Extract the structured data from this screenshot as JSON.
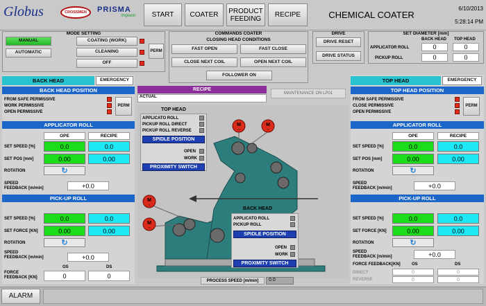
{
  "header": {
    "logo_text": "Globus",
    "badge_text": "CROSSMEN",
    "prisma_text": "PRISMA",
    "prisma_sub": "implanti",
    "nav": [
      "START",
      "COATER",
      "PRODUCT FEEDING",
      "RECIPE"
    ],
    "screen_title": "CHEMICAL COATER",
    "date": "6/10/2013",
    "time": "5:28:14 PM"
  },
  "mode": {
    "title": "MODE SETTING",
    "manual": "MANUAL",
    "automatic": "AUTOMATIC",
    "coating": "COATING (WORK)",
    "cleaning": "CLEANING",
    "off": "OFF",
    "perm": "PERM"
  },
  "commands": {
    "title": "COMMANDS COATER",
    "subtitle": "CLOSING HEAD CONDITIONS",
    "fast_open": "FAST OPEN",
    "fast_close": "FAST CLOSE",
    "close_next": "CLOSE NEXT COIL",
    "open_next": "OPEN NEXT COIL",
    "follower": "FOLLOWER ON"
  },
  "drive": {
    "title": "DRIVE",
    "reset": "DRIVE RESET",
    "status": "DRIVE STATUS"
  },
  "diameter": {
    "title": "SET DIAMETER [mm]",
    "col_back": "BACK HEAD",
    "col_top": "TOP HEAD",
    "applicator_label": "APPLICATOR ROLL",
    "pickup_label": "PICKUP ROLL",
    "app_back": "0",
    "app_top": "0",
    "pick_back": "0",
    "pick_top": "0"
  },
  "back": {
    "title": "BACK HEAD",
    "emergency": "EMERGENCY",
    "pos_title": "BACK HEAD POSITION",
    "safe": "FROM SAFE PERMISSIVE",
    "work": "WORK PERMISSIVE",
    "open": "OPEN PERMISSIVE",
    "perm": "PERM",
    "app_title": "APPLICATOR ROLL",
    "ope": "OPE",
    "recipe": "RECIPE",
    "set_speed": "SET SPEED [%]",
    "set_pos": "SET POS [mm]",
    "rotation": "ROTATION",
    "speed_fb_1": "SPEED",
    "speed_fb_2": "FEEDBACK [m/min]",
    "app_speed_ope": "0.0",
    "app_speed_rec": "0.0",
    "app_pos_ope": "0.00",
    "app_pos_rec": "0.00",
    "app_fb": "+0.0",
    "pick_title": "PICK-UP ROLL",
    "set_force": "SET FORCE [KN]",
    "pick_speed_ope": "0.0",
    "pick_speed_rec": "0.0",
    "pick_force_ope": "0.00",
    "pick_force_rec": "0.00",
    "pick_fb": "+0.0",
    "force_fb_1": "FORCE",
    "force_fb_2": "FEEDBACK [KN]",
    "os": "OS",
    "ds": "DS",
    "force_os": "0",
    "force_ds": "0"
  },
  "top": {
    "title": "TOP HEAD",
    "emergency": "EMERGENCY",
    "pos_title": "TOP HEAD POSITION",
    "safe": "FROM SAFE PERMISSIVE",
    "close": "CLOSE PERMISSIVE",
    "open": "OPEN PERMISSIVE",
    "perm": "PERM",
    "app_title": "APPLICATOR ROLL",
    "ope": "OPE",
    "recipe": "RECIPE",
    "set_speed": "SET SPEED [%]",
    "set_pos": "SET POS [mm]",
    "rotation": "ROTATION",
    "speed_fb_1": "SPEED",
    "speed_fb_2": "FEEDBACK [m/min]",
    "app_speed_ope": "0.0",
    "app_speed_rec": "0.0",
    "app_pos_ope": "0.00",
    "app_pos_rec": "0.00",
    "app_fb": "+0.0",
    "pick_title": "PICK-UP ROLL",
    "set_force": "SET FORCE [KN]",
    "pick_speed_ope": "0.0",
    "pick_speed_rec": "0.0",
    "pick_force_ope": "0.00",
    "pick_force_rec": "0.00",
    "pick_fb": "+0.0",
    "force_fb": "FORCE FEEDBACK[KN]",
    "os": "OS",
    "ds": "DS",
    "direct": "DIRECT",
    "reverse": "REVERSE",
    "dir_os": "0",
    "dir_ds": "0",
    "rev_os": "0",
    "rev_ds": "0"
  },
  "center": {
    "recipe_label": "RECIPE",
    "actual_label": "ACTUAL",
    "maintenance": "MAINTENANCE ON LP01",
    "top_head": "TOP HEAD",
    "top_items": [
      "APPLICATO ROLL",
      "PICKUP ROLL DIRECT",
      "PICKUP ROLL REVERSE"
    ],
    "spindle": "SPIDLE POSITION",
    "open": "OPEN",
    "work": "WORK",
    "proximity": "PROXIMITY SWITCH",
    "back_head": "BACK HEAD",
    "back_items": [
      "APPLICATO ROLL",
      "PICKUP ROLL"
    ],
    "back_spindle": "SPIDLE POSITION",
    "back_proximity": "PROXIMITY SWITCH",
    "process_speed_label": "PROCESS SPEED [m/min]",
    "process_speed": "0.0",
    "motor_symbol": "M"
  },
  "footer": {
    "alarm": "ALARM"
  }
}
